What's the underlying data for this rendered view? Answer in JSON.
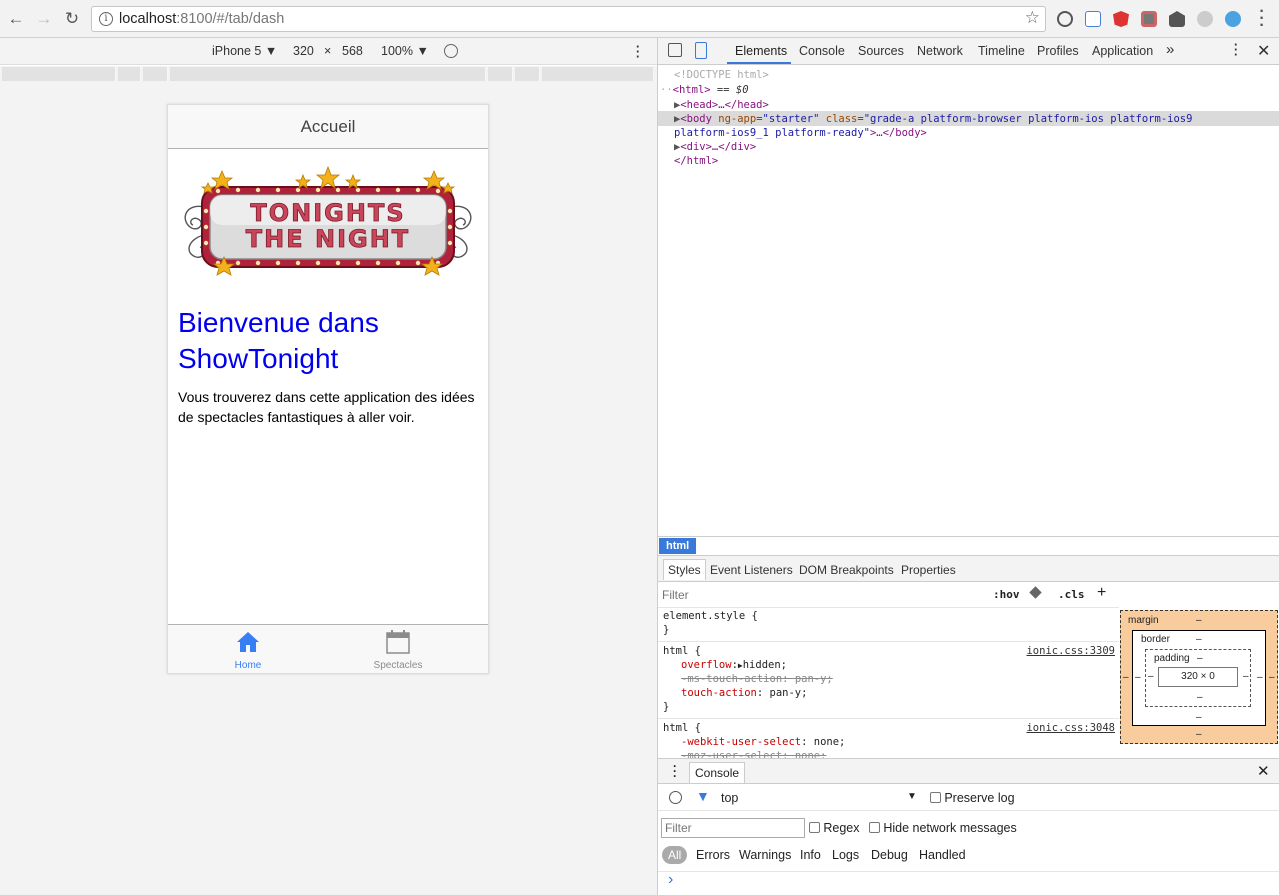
{
  "browser": {
    "url_host": "localhost",
    "url_path": ":8100/#/tab/dash"
  },
  "device_toolbar": {
    "device": "iPhone 5 ▼",
    "width": "320",
    "times": "×",
    "height": "568",
    "zoom": "100% ▼"
  },
  "app": {
    "header_title": "Accueil",
    "banner_line1": "TONIGHTS",
    "banner_line2": "THE NIGHT",
    "welcome_title": "Bienvenue dans ShowTonight",
    "welcome_text": "Vous trouverez dans cette application des idées de spectacles fantastiques à aller voir.",
    "tabs": [
      {
        "label": "Home",
        "active": true
      },
      {
        "label": "Spectacles",
        "active": false
      }
    ],
    "colors": {
      "link_blue": "#0000ee",
      "tab_active": "#387ef5",
      "tab_inactive": "#8c8c8c"
    }
  },
  "devtools": {
    "tabs": [
      "Elements",
      "Console",
      "Sources",
      "Network",
      "Timeline",
      "Profiles",
      "Application",
      "»"
    ],
    "dom": {
      "doctype": "<!DOCTYPE html>",
      "html_open": "<html>",
      "html_marker": " == $0",
      "head": "<head>…</head>",
      "body_tag": "<body ",
      "body_attr1": "ng-app",
      "body_val1": "\"starter\"",
      "body_attr2": "class",
      "body_val2a": "\"grade-a platform-browser platform-ios platform-ios9",
      "body_val2b": "platform-ios9_1 platform-ready\"",
      "body_end": ">…</body>",
      "div": "<div>…</div>",
      "html_close": "</html>"
    },
    "breadcrumb": "html",
    "sub_tabs": [
      "Styles",
      "Event Listeners",
      "DOM Breakpoints",
      "Properties"
    ],
    "styles": {
      "filter_placeholder": "Filter",
      "hov": ":hov",
      "cls": ".cls",
      "plus": "+",
      "element_style": "element.style {",
      "close_brace": "}",
      "rule1_selector": "html {",
      "rule1_source": "ionic.css:3309",
      "rule1_props": [
        {
          "name": "overflow",
          "value": "hidden;",
          "struck": false,
          "arrow": true
        },
        {
          "name": "-ms-touch-action",
          "value": "pan-y;",
          "struck": true,
          "arrow": false
        },
        {
          "name": "touch-action",
          "value": "pan-y;",
          "struck": false,
          "arrow": false
        }
      ],
      "rule2_selector": "html {",
      "rule2_source": "ionic.css:3048",
      "rule2_props": [
        {
          "name": "-webkit-user-select",
          "value": "none;"
        },
        {
          "name": "-moz-user-select",
          "value": "none;"
        }
      ]
    },
    "box_model": {
      "margin_label": "margin",
      "border_label": "border",
      "padding_label": "padding",
      "content": "320 × 0",
      "dash": "–"
    },
    "console": {
      "title": "Console",
      "context": "top",
      "preserve_log": "Preserve log",
      "filter_placeholder": "Filter",
      "regex": "Regex",
      "hide_network": "Hide network messages",
      "levels": [
        "All",
        "Errors",
        "Warnings",
        "Info",
        "Logs",
        "Debug",
        "Handled"
      ],
      "prompt": "›"
    }
  }
}
